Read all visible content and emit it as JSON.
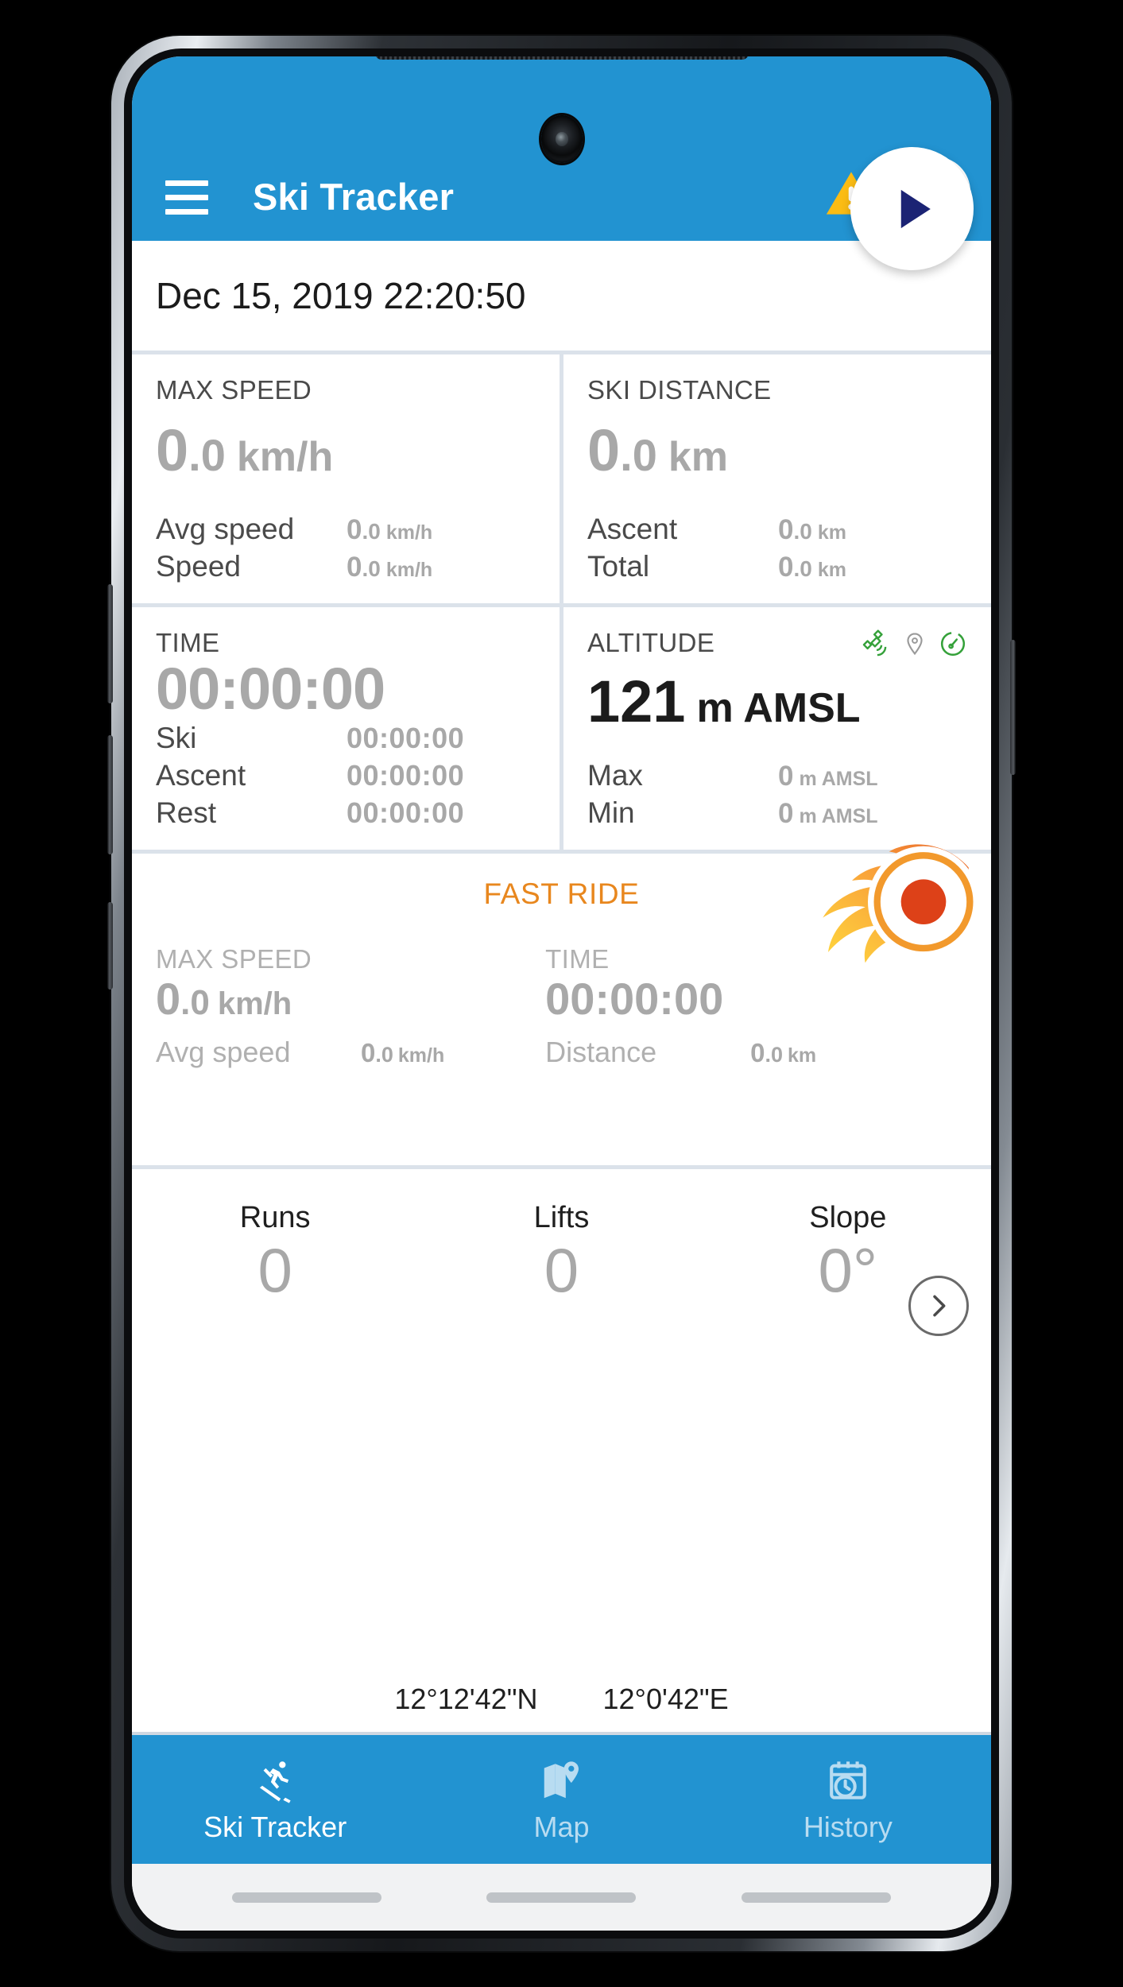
{
  "app": {
    "title": "Ski Tracker",
    "accent_color": "#2293d1",
    "warning_color": "#fbbc14",
    "fast_ride_color": "#e8871e",
    "value_gray": "#a8a8a8"
  },
  "appbar": {
    "menu_label": "menu",
    "warning_label": "warning",
    "ski_badge_label": "ski-mode",
    "start_label": "start"
  },
  "session": {
    "datetime": "Dec 15, 2019 22:20:50"
  },
  "cards": {
    "max_speed": {
      "title": "MAX SPEED",
      "value_int": "0",
      "value_frac": ".0",
      "unit": "km/h",
      "rows": [
        {
          "label": "Avg speed",
          "int": "0",
          "frac": ".0",
          "unit": "km/h"
        },
        {
          "label": "Speed",
          "int": "0",
          "frac": ".0",
          "unit": "km/h"
        }
      ]
    },
    "ski_distance": {
      "title": "SKI DISTANCE",
      "value_int": "0",
      "value_frac": ".0",
      "unit": "km",
      "rows": [
        {
          "label": "Ascent",
          "int": "0",
          "frac": ".0",
          "unit": "km"
        },
        {
          "label": "Total",
          "int": "0",
          "frac": ".0",
          "unit": "km"
        }
      ]
    },
    "time": {
      "title": "TIME",
      "value_int": "00:00:00",
      "value_frac": "",
      "unit": "",
      "rows": [
        {
          "label": "Ski",
          "int": "00:00:00",
          "frac": "",
          "unit": ""
        },
        {
          "label": "Ascent",
          "int": "00:00:00",
          "frac": "",
          "unit": ""
        },
        {
          "label": "Rest",
          "int": "00:00:00",
          "frac": "",
          "unit": ""
        }
      ]
    },
    "altitude": {
      "title": "ALTITUDE",
      "value_int": "121",
      "value_frac": "",
      "unit": "m AMSL",
      "icons": [
        "satellite-icon",
        "location-pin-icon",
        "barometer-icon"
      ],
      "rows": [
        {
          "label": "Max",
          "int": "0",
          "frac": "",
          "unit": "m AMSL"
        },
        {
          "label": "Min",
          "int": "0",
          "frac": "",
          "unit": "m AMSL"
        }
      ]
    }
  },
  "fast_ride": {
    "title": "FAST RIDE",
    "max_speed_label": "MAX SPEED",
    "max_speed_int": "0",
    "max_speed_frac": ".0",
    "max_speed_unit": "km/h",
    "time_label": "TIME",
    "time_value": "00:00:00",
    "avg_speed_label": "Avg speed",
    "avg_speed_int": "0",
    "avg_speed_frac": ".0",
    "avg_speed_unit": "km/h",
    "distance_label": "Distance",
    "distance_int": "0",
    "distance_frac": ".0",
    "distance_unit": "km"
  },
  "stats": {
    "items": [
      {
        "label": "Runs",
        "value": "0"
      },
      {
        "label": "Lifts",
        "value": "0"
      },
      {
        "label": "Slope",
        "value": "0°"
      }
    ],
    "latitude": "12°12'42\"N",
    "longitude": "12°0'42\"E"
  },
  "bottom_nav": [
    {
      "label": "Ski Tracker",
      "icon": "skier-icon",
      "active": true
    },
    {
      "label": "Map",
      "icon": "map-pin-icon",
      "active": false
    },
    {
      "label": "History",
      "icon": "calendar-clock-icon",
      "active": false
    }
  ]
}
